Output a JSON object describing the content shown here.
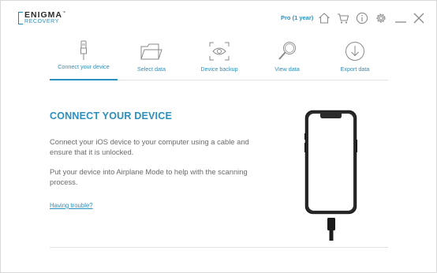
{
  "app": {
    "logo_top": "ENIGMA",
    "logo_tm": "™",
    "logo_bottom": "RECOVERY",
    "plan": "Pro (1 year)"
  },
  "toolbar_icons": [
    "home-icon",
    "cart-icon",
    "info-icon",
    "gear-icon",
    "minimize-icon",
    "close-icon"
  ],
  "steps": [
    {
      "label": "Connect your device",
      "icon": "usb-cable-icon",
      "active": true
    },
    {
      "label": "Select data",
      "icon": "folder-icon",
      "active": false
    },
    {
      "label": "Device backup",
      "icon": "eye-scan-icon",
      "active": false
    },
    {
      "label": "View data",
      "icon": "magnifier-icon",
      "active": false
    },
    {
      "label": "Export data",
      "icon": "download-icon",
      "active": false
    }
  ],
  "main": {
    "title": "CONNECT YOUR DEVICE",
    "paragraph1": "Connect your iOS device to your computer using a cable and ensure that it is unlocked.",
    "paragraph2": "Put your device into Airplane Mode to help with the scanning process.",
    "trouble_link": "Having trouble?"
  },
  "colors": {
    "accent": "#2b8fbf",
    "text": "#6b6b6b",
    "icon": "#8a8a8a"
  }
}
